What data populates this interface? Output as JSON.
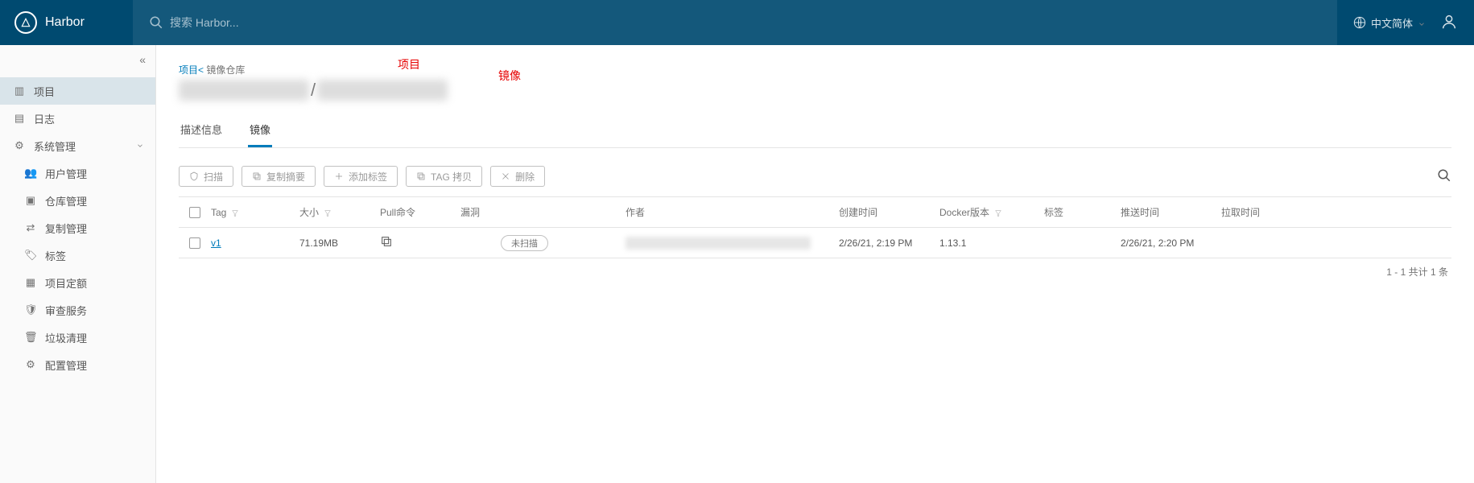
{
  "header": {
    "app_name": "Harbor",
    "search_placeholder": "搜索 Harbor...",
    "language": "中文简体"
  },
  "annotations": {
    "a1": "项目",
    "a2": "镜像"
  },
  "sidebar": {
    "items": [
      {
        "label": "项目",
        "icon": "projects"
      },
      {
        "label": "日志",
        "icon": "logs"
      },
      {
        "label": "系统管理",
        "icon": "admin",
        "expandable": true
      }
    ],
    "subitems": [
      {
        "label": "用户管理",
        "icon": "users"
      },
      {
        "label": "仓库管理",
        "icon": "registry"
      },
      {
        "label": "复制管理",
        "icon": "replication"
      },
      {
        "label": "标签",
        "icon": "labels"
      },
      {
        "label": "项目定额",
        "icon": "quotas"
      },
      {
        "label": "审查服务",
        "icon": "interrogation"
      },
      {
        "label": "垃圾清理",
        "icon": "gc"
      },
      {
        "label": "配置管理",
        "icon": "config"
      }
    ]
  },
  "breadcrumb": {
    "root": "项目",
    "mid": "镜像仓库"
  },
  "repo_title": {
    "sep": "/"
  },
  "tabs": [
    {
      "label": "描述信息"
    },
    {
      "label": "镜像",
      "active": true
    }
  ],
  "toolbar": {
    "scan": "扫描",
    "copy_digest": "复制摘要",
    "add_labels": "添加标签",
    "copy_tag": "TAG 拷贝",
    "delete": "删除"
  },
  "columns": {
    "tag": "Tag",
    "size": "大小",
    "pull": "Pull命令",
    "vuln": "漏洞",
    "author": "作者",
    "created": "创建时间",
    "docker": "Docker版本",
    "labels": "标签",
    "push": "推送时间",
    "pull_time": "拉取时间"
  },
  "rows": [
    {
      "tag": "v1",
      "size": "71.19MB",
      "scan": "未扫描",
      "created": "2/26/21, 2:19 PM",
      "docker": "1.13.1",
      "labels": "",
      "push": "2/26/21, 2:20 PM"
    }
  ],
  "pager": "1 - 1 共计 1 条"
}
